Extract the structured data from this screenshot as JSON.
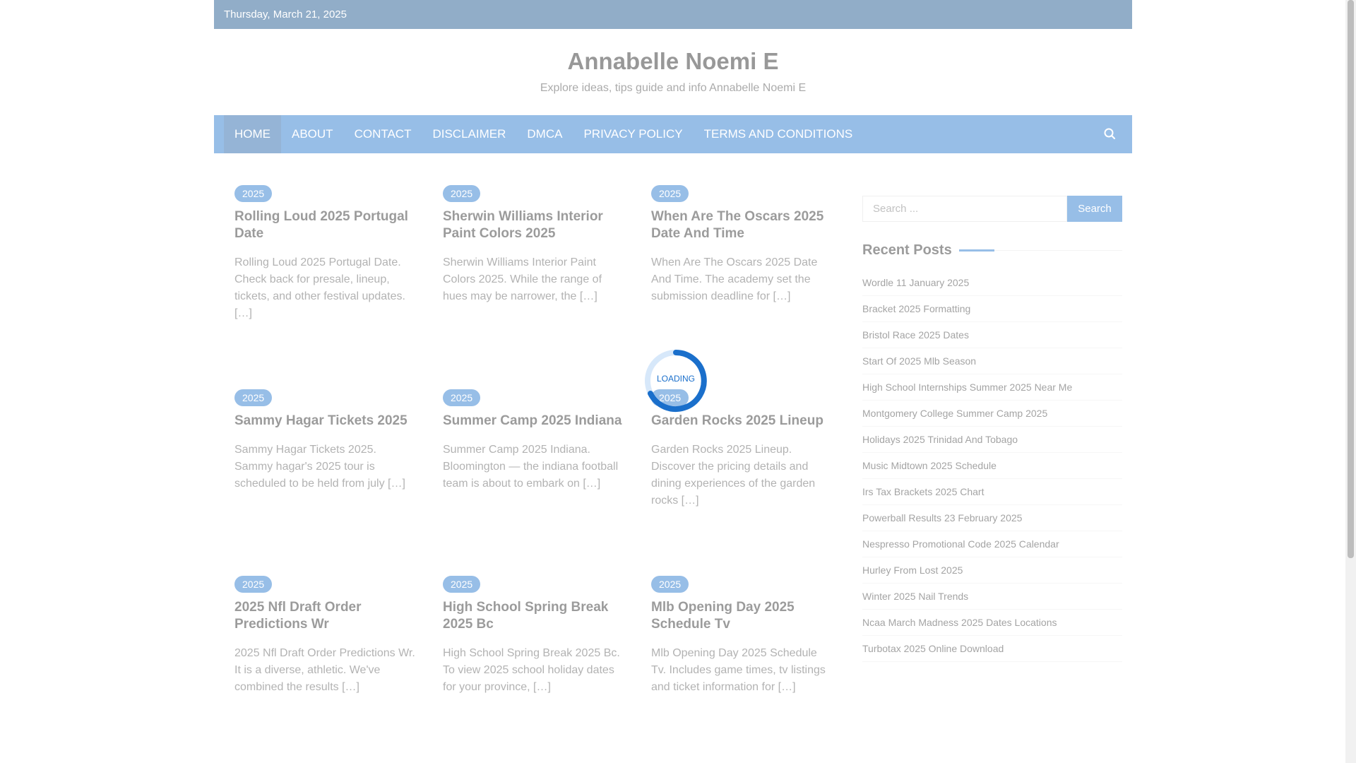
{
  "topbar": {
    "date": "Thursday, March 21, 2025"
  },
  "header": {
    "title": "Annabelle Noemi E",
    "description": "Explore ideas, tips guide and info Annabelle Noemi E"
  },
  "nav": {
    "items": [
      "HOME",
      "ABOUT",
      "CONTACT",
      "DISCLAIMER",
      "DMCA",
      "PRIVACY POLICY",
      "TERMS AND CONDITIONS"
    ],
    "active": "HOME",
    "search_icon": "search-icon"
  },
  "posts": [
    {
      "badge": "2025",
      "title": "Rolling Loud 2025 Portugal Date",
      "excerpt": "Rolling Loud 2025 Portugal Date. Check back for presale, lineup, tickets, and other festival updates. […]"
    },
    {
      "badge": "2025",
      "title": "Sherwin Williams Interior Paint Colors 2025",
      "excerpt": "Sherwin Williams Interior Paint Colors 2025. While the range of hues may be narrower, the […]"
    },
    {
      "badge": "2025",
      "title": "When Are The Oscars 2025 Date And Time",
      "excerpt": "When Are The Oscars 2025 Date And Time. The academy set the submission deadline for […]"
    },
    {
      "badge": "2025",
      "title": "Sammy Hagar Tickets 2025",
      "excerpt": "Sammy Hagar Tickets 2025. Sammy hagar's 2025 tour is scheduled to be held from july […]"
    },
    {
      "badge": "2025",
      "title": "Summer Camp 2025 Indiana",
      "excerpt": "Summer Camp 2025 Indiana. Bloomington — the indiana football team is about to embark on […]"
    },
    {
      "badge": "2025",
      "title": "Garden Rocks 2025 Lineup",
      "excerpt": "Garden Rocks 2025 Lineup. Discover the pricing details and dining experiences of the garden rocks […]"
    },
    {
      "badge": "2025",
      "title": "2025 Nfl Draft Order Predictions Wr",
      "excerpt": "2025 Nfl Draft Order Predictions Wr. It is a diverse, athletic. We've combined the results […]"
    },
    {
      "badge": "2025",
      "title": "High School Spring Break 2025 Bc",
      "excerpt": "High School Spring Break 2025 Bc. To view 2025 school holiday dates for your province, […]"
    },
    {
      "badge": "2025",
      "title": "Mlb Opening Day 2025 Schedule Tv",
      "excerpt": "Mlb Opening Day 2025 Schedule Tv. Includes game times, tv listings and ticket information for […]"
    }
  ],
  "sidebar": {
    "search_placeholder": "Search ...",
    "search_button": "Search",
    "recent_title": "Recent Posts",
    "recent": [
      "Wordle 11 January 2025",
      "Bracket 2025 Formatting",
      "Bristol Race 2025 Dates",
      "Start Of 2025 Mlb Season",
      "High School Internships Summer 2025 Near Me",
      "Montgomery College Summer Camp 2025",
      "Holidays 2025 Trinidad And Tobago",
      "Music Midtown 2025 Schedule",
      "Irs Tax Brackets 2025 Chart",
      "Powerball Results 23 February 2025",
      "Nespresso Promotional Code 2025 Calendar",
      "Hurley From Lost 2025",
      "Winter 2025 Nail Trends",
      "Ncaa March Madness 2025 Dates Locations",
      "Turbotax 2025 Online Download"
    ]
  },
  "loader": {
    "text": "LOADING"
  },
  "colors": {
    "primary": "#1a6fcb",
    "topbar": "#0d4a86",
    "nav_active": "#155aa5"
  }
}
